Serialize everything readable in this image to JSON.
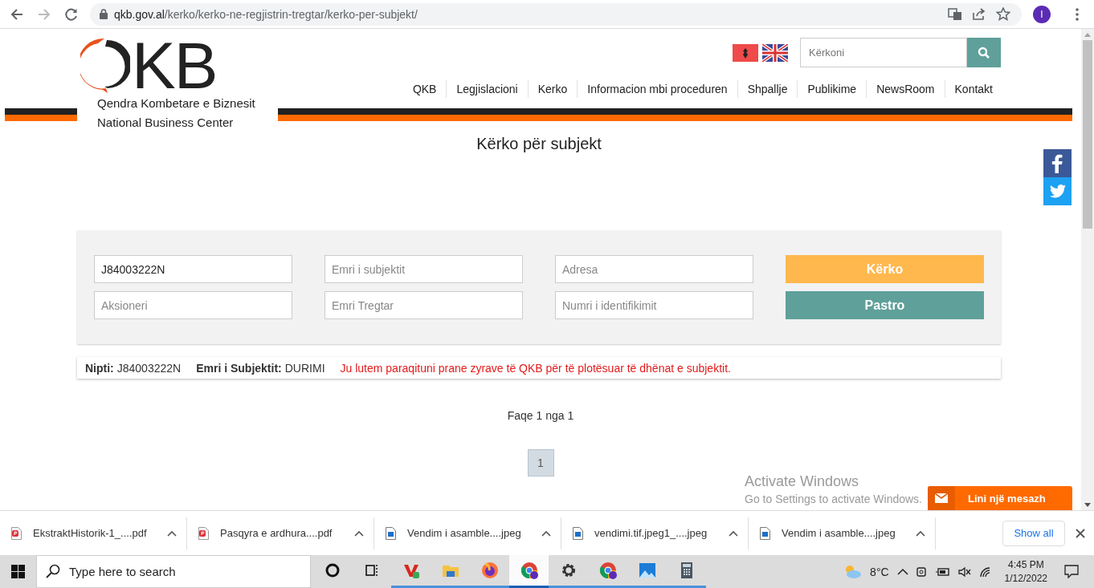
{
  "browser": {
    "url_host": "qkb.gov.al",
    "url_path": "/kerko/kerko-ne-regjistrin-tregtar/kerko-per-subjekt/",
    "profile": "I"
  },
  "header": {
    "logo": "KB",
    "tagline": [
      "Qendra Kombetare e Biznesit",
      "National Business Center"
    ],
    "search": {
      "placeholder": "Kërkoni"
    },
    "nav": [
      {
        "label": "QKB"
      },
      {
        "label": "Legjislacioni"
      },
      {
        "label": "Kerko"
      },
      {
        "label": "Informacion mbi proceduren"
      },
      {
        "label": "Shpallje"
      },
      {
        "label": "Publikime"
      },
      {
        "label": "NewsRoom"
      },
      {
        "label": "Kontakt"
      }
    ]
  },
  "page_title": "Kërko për subjekt",
  "form": {
    "cells": [
      {
        "kind": "field",
        "value": "J84003222N"
      },
      {
        "kind": "field",
        "placeholder": "Emri i subjektit"
      },
      {
        "kind": "field",
        "placeholder": "Adresa"
      },
      {
        "kind": "search",
        "label": "Kërko"
      },
      {
        "kind": "field",
        "placeholder": "Aksioneri"
      },
      {
        "kind": "field",
        "placeholder": "Emri Tregtar"
      },
      {
        "kind": "field",
        "placeholder": "Numri i identifikimit"
      },
      {
        "kind": "clear",
        "label": "Pastro"
      }
    ]
  },
  "result": {
    "nipti_label": "Nipti:",
    "nipti": "J84003222N",
    "name_label": "Emri i Subjektit:",
    "name": "DURIMI",
    "message": "Ju lutem paraqituni prane zyrave të QKB për të plotësuar të dhënat e subjektit."
  },
  "pagination": {
    "summary": "Faqe 1 nga 1",
    "pages": [
      {
        "label": "1",
        "selected": true
      }
    ]
  },
  "message_button": "Lini një mesazh",
  "downloads": [
    {
      "kind": "pdf",
      "name": "EkstraktHistorik-1_....pdf"
    },
    {
      "kind": "pdf",
      "name": "Pasqyra e ardhura....pdf"
    },
    {
      "kind": "image",
      "name": "Vendim i asamble....jpeg"
    },
    {
      "kind": "image",
      "name": "vendimi.tif.jpeg1_....jpeg"
    },
    {
      "kind": "image",
      "name": "Vendim i asamble....jpeg"
    }
  ],
  "show_all": "Show all",
  "os_notice": {
    "title": "Activate Windows",
    "text": "Go to Settings to activate Windows."
  },
  "taskbar": {
    "search": {
      "placeholder": "Type here to search"
    },
    "apps": [
      {
        "kind": "cortana",
        "running": false,
        "selected": false
      },
      {
        "kind": "taskview",
        "running": false,
        "selected": false
      },
      {
        "kind": "office",
        "running": true,
        "selected": false
      },
      {
        "kind": "files",
        "running": true,
        "selected": false
      },
      {
        "kind": "firefox",
        "running": true,
        "selected": false
      },
      {
        "kind": "chrome",
        "running": true,
        "selected": true
      },
      {
        "kind": "settings",
        "running": true,
        "selected": false
      },
      {
        "kind": "chrome",
        "running": true,
        "selected": false
      },
      {
        "kind": "photos",
        "running": true,
        "selected": false
      },
      {
        "kind": "calculator",
        "running": true,
        "selected": false
      }
    ],
    "temperature": "8°C",
    "time": "4:45 PM",
    "date": "1/12/2022"
  }
}
